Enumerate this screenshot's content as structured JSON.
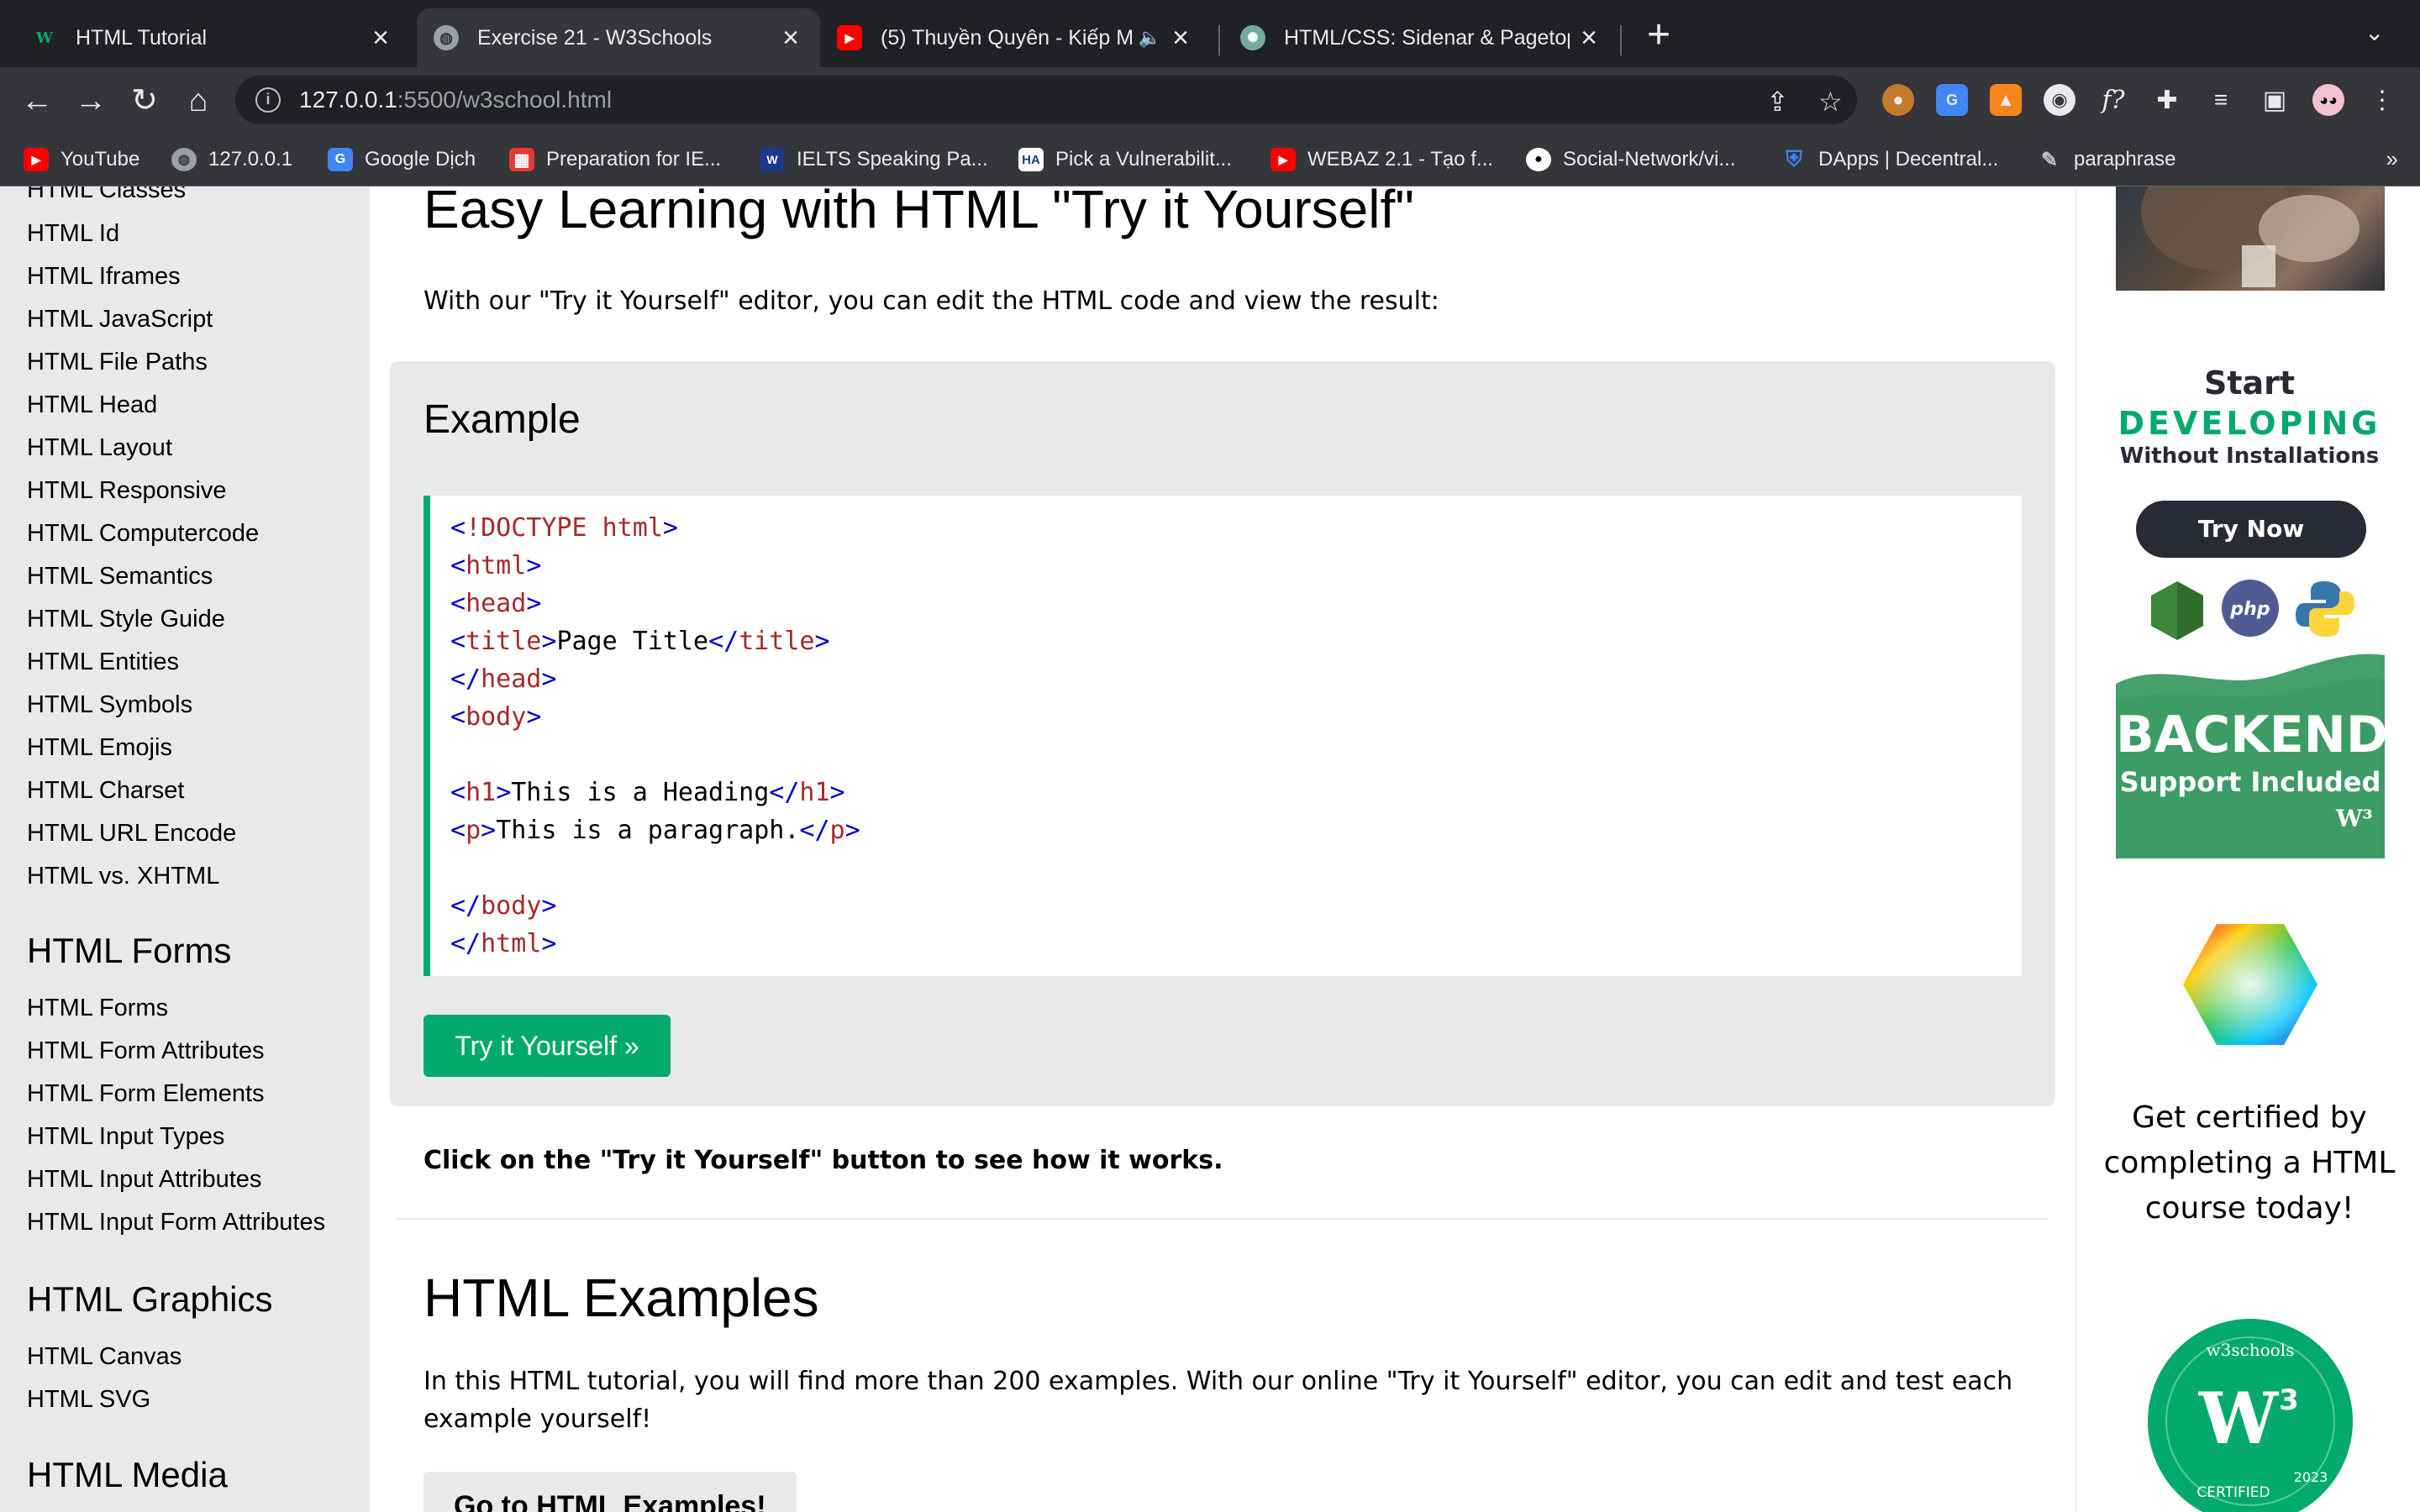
{
  "browser": {
    "tabs": [
      {
        "title": "HTML Tutorial",
        "favicon": "w3schools-icon",
        "active": false
      },
      {
        "title": "Exercise 21 - W3Schools",
        "favicon": "globe-icon",
        "active": true
      },
      {
        "title": "(5) Thuyền Quyên - Kiếp M",
        "favicon": "youtube-icon",
        "active": false,
        "audio": true
      },
      {
        "title": "HTML/CSS: Sidenar & Pagetop",
        "favicon": "chatgpt-icon",
        "active": false
      }
    ],
    "url_host": "127.0.0.1",
    "url_path": ":5500/w3school.html",
    "bookmarks": [
      {
        "label": "YouTube",
        "icon": "youtube-icon",
        "color": "#ff0000"
      },
      {
        "label": "127.0.0.1",
        "icon": "globe-icon",
        "color": "#9aa0a6"
      },
      {
        "label": "Google Dịch",
        "icon": "google-translate-icon",
        "color": "#4285f4"
      },
      {
        "label": "Preparation for IE...",
        "icon": "grid-icon",
        "color": "#e53935"
      },
      {
        "label": "IELTS Speaking Pa...",
        "icon": "ielts-icon",
        "color": "#1e3a8a"
      },
      {
        "label": "Pick a Vulnerabilit...",
        "icon": "ha-icon",
        "color": "#ffffff"
      },
      {
        "label": "WEBAZ 2.1 - Tạo f...",
        "icon": "youtube-icon",
        "color": "#ff0000"
      },
      {
        "label": "Social-Network/vi...",
        "icon": "github-icon",
        "color": "#ffffff"
      },
      {
        "label": "DApps | Decentral...",
        "icon": "shield-icon",
        "color": "#3b82f6"
      },
      {
        "label": "paraphrase",
        "icon": "pencil-icon",
        "color": "#bdc1c6"
      }
    ],
    "more_bookmarks": "»"
  },
  "sidebar": {
    "groups": [
      {
        "heading": "",
        "links": [
          "HTML Classes",
          "HTML Id",
          "HTML Iframes",
          "HTML JavaScript",
          "HTML File Paths",
          "HTML Head",
          "HTML Layout",
          "HTML Responsive",
          "HTML Computercode",
          "HTML Semantics",
          "HTML Style Guide",
          "HTML Entities",
          "HTML Symbols",
          "HTML Emojis",
          "HTML Charset",
          "HTML URL Encode",
          "HTML vs. XHTML"
        ]
      },
      {
        "heading": "HTML Forms",
        "links": [
          "HTML Forms",
          "HTML Form Attributes",
          "HTML Form Elements",
          "HTML Input Types",
          "HTML Input Attributes",
          "HTML Input Form Attributes"
        ]
      },
      {
        "heading": "HTML Graphics",
        "links": [
          "HTML Canvas",
          "HTML SVG"
        ]
      },
      {
        "heading": "HTML Media",
        "links": []
      }
    ]
  },
  "main": {
    "heading": "Easy Learning with HTML \"Try it Yourself\"",
    "intro": "With our \"Try it Yourself\" editor, you can edit the HTML code and view the result:",
    "example": {
      "title": "Example",
      "code_lines": [
        [
          "<!DOCTYPE",
          " html",
          ">"
        ],
        [
          "<",
          "html",
          ">"
        ],
        [
          "<",
          "head",
          ">"
        ],
        [
          "<",
          "title",
          ">",
          "Page Title",
          "</",
          "title",
          ">"
        ],
        [
          "</",
          "head",
          ">"
        ],
        [
          "<",
          "body",
          ">"
        ],
        [],
        [
          "<",
          "h1",
          ">",
          "This is a Heading",
          "</",
          "h1",
          ">"
        ],
        [
          "<",
          "p",
          ">",
          "This is a paragraph.",
          "</",
          "p",
          ">"
        ],
        [],
        [
          "</",
          "body",
          ">"
        ],
        [
          "</",
          "html",
          ">"
        ]
      ],
      "try_button": "Try it Yourself »"
    },
    "note": "Click on the \"Try it Yourself\" button to see how it works.",
    "examples_heading": "HTML Examples",
    "examples_text": "In this HTML tutorial, you will find more than 200 examples. With our online \"Try it Yourself\" editor, you can edit and test each example yourself!",
    "go_button": "Go to HTML Examples!"
  },
  "ads": {
    "start": "Start",
    "developing": "DEVELOPING",
    "without": "Without Installations",
    "try_now": "Try Now",
    "tech_icons": [
      "nodejs-icon",
      "php-icon",
      "python-icon"
    ],
    "php_label": "php",
    "backend": "BACKEND",
    "support": "Support Included",
    "backend_logo": "w3schools-logo",
    "cert_text": "Get certified by completing a HTML course today!",
    "badge_top": "w3schools",
    "badge_bottom": "CERTIFIED",
    "badge_year": "2023",
    "green": "#04aa6d"
  }
}
